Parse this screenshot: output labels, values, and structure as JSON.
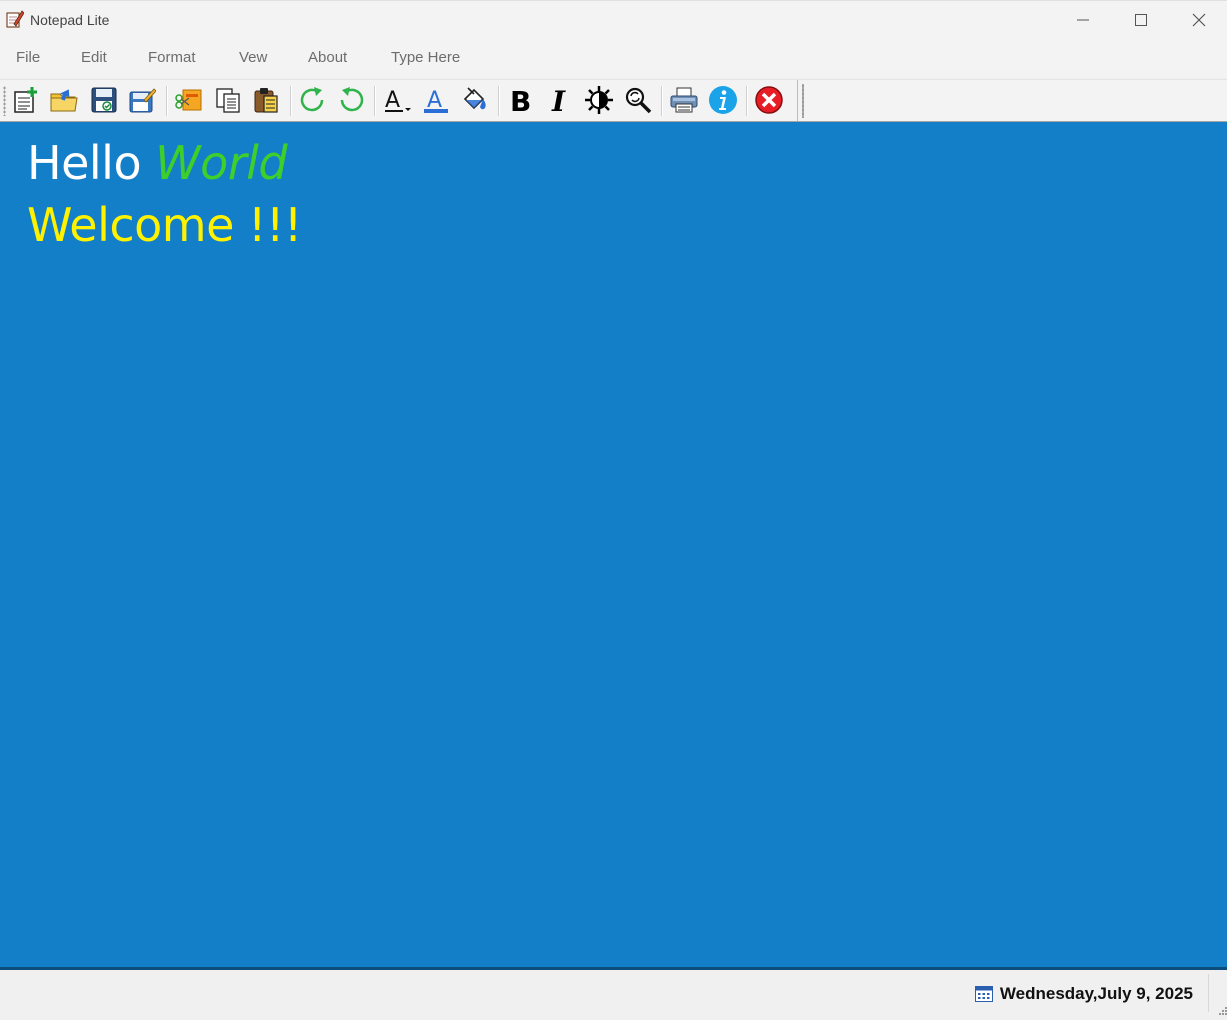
{
  "window": {
    "title": "Notepad Lite"
  },
  "menu": {
    "items": [
      {
        "label": "File"
      },
      {
        "label": "Edit"
      },
      {
        "label": "Format"
      },
      {
        "label": "Vew"
      },
      {
        "label": "About"
      },
      {
        "label": "Type Here"
      }
    ]
  },
  "toolbar": {
    "buttons": [
      "new-file-icon",
      "open-folder-icon",
      "save-icon",
      "save-as-icon",
      "cut-icon",
      "copy-icon",
      "paste-icon",
      "redo-icon",
      "undo-icon",
      "font-icon",
      "font-color-icon",
      "fill-color-icon",
      "bold-icon",
      "italic-icon",
      "theme-icon",
      "find-icon",
      "print-icon",
      "info-icon",
      "exit-icon"
    ]
  },
  "editor": {
    "line1_a": "Hello",
    "line1_b": "World",
    "line2": "Welcome !!!",
    "background": "#137fc8",
    "color_hello": "#ffffff",
    "color_world": "#3fcf2a",
    "color_welcome": "#fff200"
  },
  "status": {
    "date": "Wednesday,July 9, 2025"
  }
}
